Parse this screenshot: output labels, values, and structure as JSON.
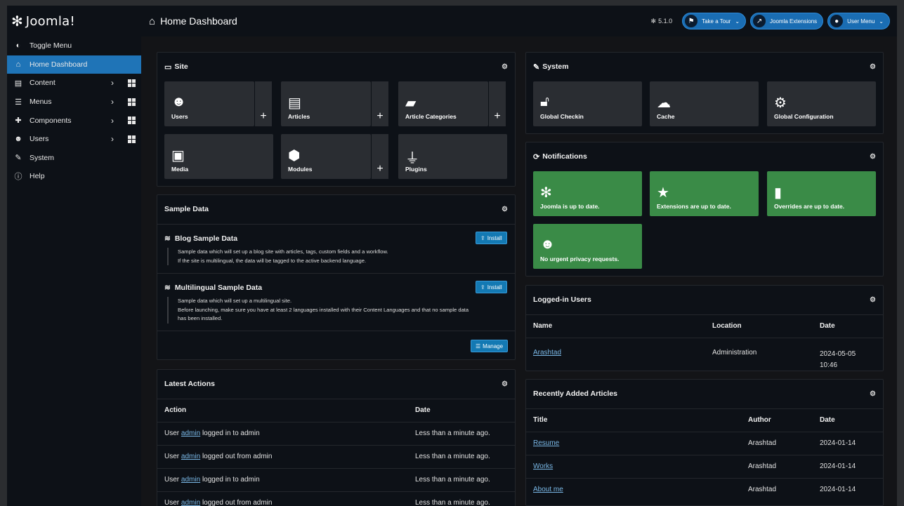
{
  "header": {
    "logo_text": "Joomla!",
    "page_title": "Home Dashboard",
    "version": "5.1.0",
    "take_tour": "Take a Tour",
    "extensions": "Joomla Extensions",
    "user_menu": "User Menu"
  },
  "sidebar": {
    "items": [
      {
        "label": "Toggle Menu"
      },
      {
        "label": "Home Dashboard"
      },
      {
        "label": "Content"
      },
      {
        "label": "Menus"
      },
      {
        "label": "Components"
      },
      {
        "label": "Users"
      },
      {
        "label": "System"
      },
      {
        "label": "Help"
      }
    ]
  },
  "site": {
    "title": "Site",
    "tiles": [
      "Users",
      "Articles",
      "Article Categories",
      "Media",
      "Modules",
      "Plugins"
    ]
  },
  "system": {
    "title": "System",
    "tiles": [
      "Global Checkin",
      "Cache",
      "Global Configuration"
    ]
  },
  "notifications": {
    "title": "Notifications",
    "tiles": [
      "Joomla is up to date.",
      "Extensions are up to date.",
      "Overrides are up to date.",
      "No urgent privacy requests."
    ]
  },
  "sample_data": {
    "title": "Sample Data",
    "items": [
      {
        "title": "Blog Sample Data",
        "line1": "Sample data which will set up a blog site with articles, tags, custom fields and a workflow.",
        "line2": "If the site is multilingual, the data will be tagged to the active backend language.",
        "line3": "",
        "button": "Install"
      },
      {
        "title": "Multilingual Sample Data",
        "line1": "Sample data which will set up a multilingual site.",
        "line2": "Before launching, make sure you have at least 2 languages installed with their Content Languages and that no sample data",
        "line3": "has been installed.",
        "button": "Install"
      }
    ],
    "manage": "Manage"
  },
  "latest_actions": {
    "title": "Latest Actions",
    "columns": [
      "Action",
      "Date"
    ],
    "rows": [
      {
        "pre": "User",
        "link": "admin",
        "post": "logged in to admin",
        "date": "Less than a minute ago."
      },
      {
        "pre": "User",
        "link": "admin",
        "post": "logged out from admin",
        "date": "Less than a minute ago."
      },
      {
        "pre": "User",
        "link": "admin",
        "post": "logged in to admin",
        "date": "Less than a minute ago."
      },
      {
        "pre": "User",
        "link": "admin",
        "post": "logged out from admin",
        "date": "Less than a minute ago."
      }
    ]
  },
  "logged_in": {
    "title": "Logged-in Users",
    "columns": [
      "Name",
      "Location",
      "Date"
    ],
    "rows": [
      {
        "name": "Arashtad",
        "location": "Administration",
        "date1": "2024-05-05",
        "date2": "10:46"
      }
    ]
  },
  "recent_articles": {
    "title": "Recently Added Articles",
    "columns": [
      "Title",
      "Author",
      "Date"
    ],
    "rows": [
      {
        "title": "Resume",
        "author": "Arashtad",
        "date": "2024-01-14"
      },
      {
        "title": "Works",
        "author": "Arashtad",
        "date": "2024-01-14"
      },
      {
        "title": "About me",
        "author": "Arashtad",
        "date": "2024-01-14"
      }
    ]
  },
  "colors": {
    "accent": "#1f74b7",
    "success": "#3a8b47",
    "panel": "#0d1117",
    "tile": "#2a2d32"
  }
}
